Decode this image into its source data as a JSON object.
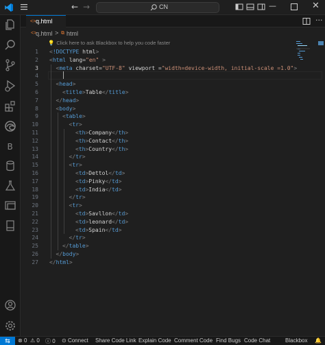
{
  "titlebar": {
    "search_text": "CN"
  },
  "tab": {
    "filename": "q.html"
  },
  "breadcrumb": {
    "file": "q.html",
    "separator": ">",
    "element": "html"
  },
  "editor": {
    "hint": "Click here to ask Blackbox to help you code faster",
    "active_line": 3,
    "line_numbers": [
      "1",
      "2",
      "3",
      "4",
      "5",
      "6",
      "7",
      "8",
      "9",
      "10",
      "11",
      "12",
      "13",
      "14",
      "15",
      "16",
      "17",
      "18",
      "19",
      "20",
      "21",
      "22",
      "23",
      "24",
      "25",
      "26",
      "27"
    ],
    "lines": [
      "<!DOCTYPE html>",
      "<html lang=\"en\" >",
      "<meta charset=\"UTF-8\" viewport =\"width=device-width, initial-scale =1.0\">",
      "",
      "<head>",
      "<title>Table</title>",
      "</head>",
      "<body>",
      "<table>",
      "<tr>",
      "<th>Company</th>",
      "<th>Contact</th>",
      "<th>Country</th>",
      "</tr>",
      "<tr>",
      "<td>Dettol</td>",
      "<td>Pinky</td>",
      "<td>India</td>",
      "</tr>",
      "<tr>",
      "<td>Savllon</td>",
      "<td>leonard</td>",
      "<td>Spain</td>",
      "</tr>",
      "</table>",
      "</body>",
      "</html>"
    ]
  },
  "statusbar": {
    "errors": "0",
    "warnings": "0",
    "info": "0",
    "connect": "Connect",
    "share": "Share Code Link",
    "explain": "Explain Code",
    "comment": "Comment Code",
    "bugs": "Find Bugs",
    "chat": "Code Chat",
    "blackbox": "Blackbox"
  },
  "colors": {
    "accent": "#0078d4",
    "tag": "#569cd6",
    "attribute": "#9cdcfe",
    "string": "#ce9178",
    "text": "#d4d4d4"
  }
}
